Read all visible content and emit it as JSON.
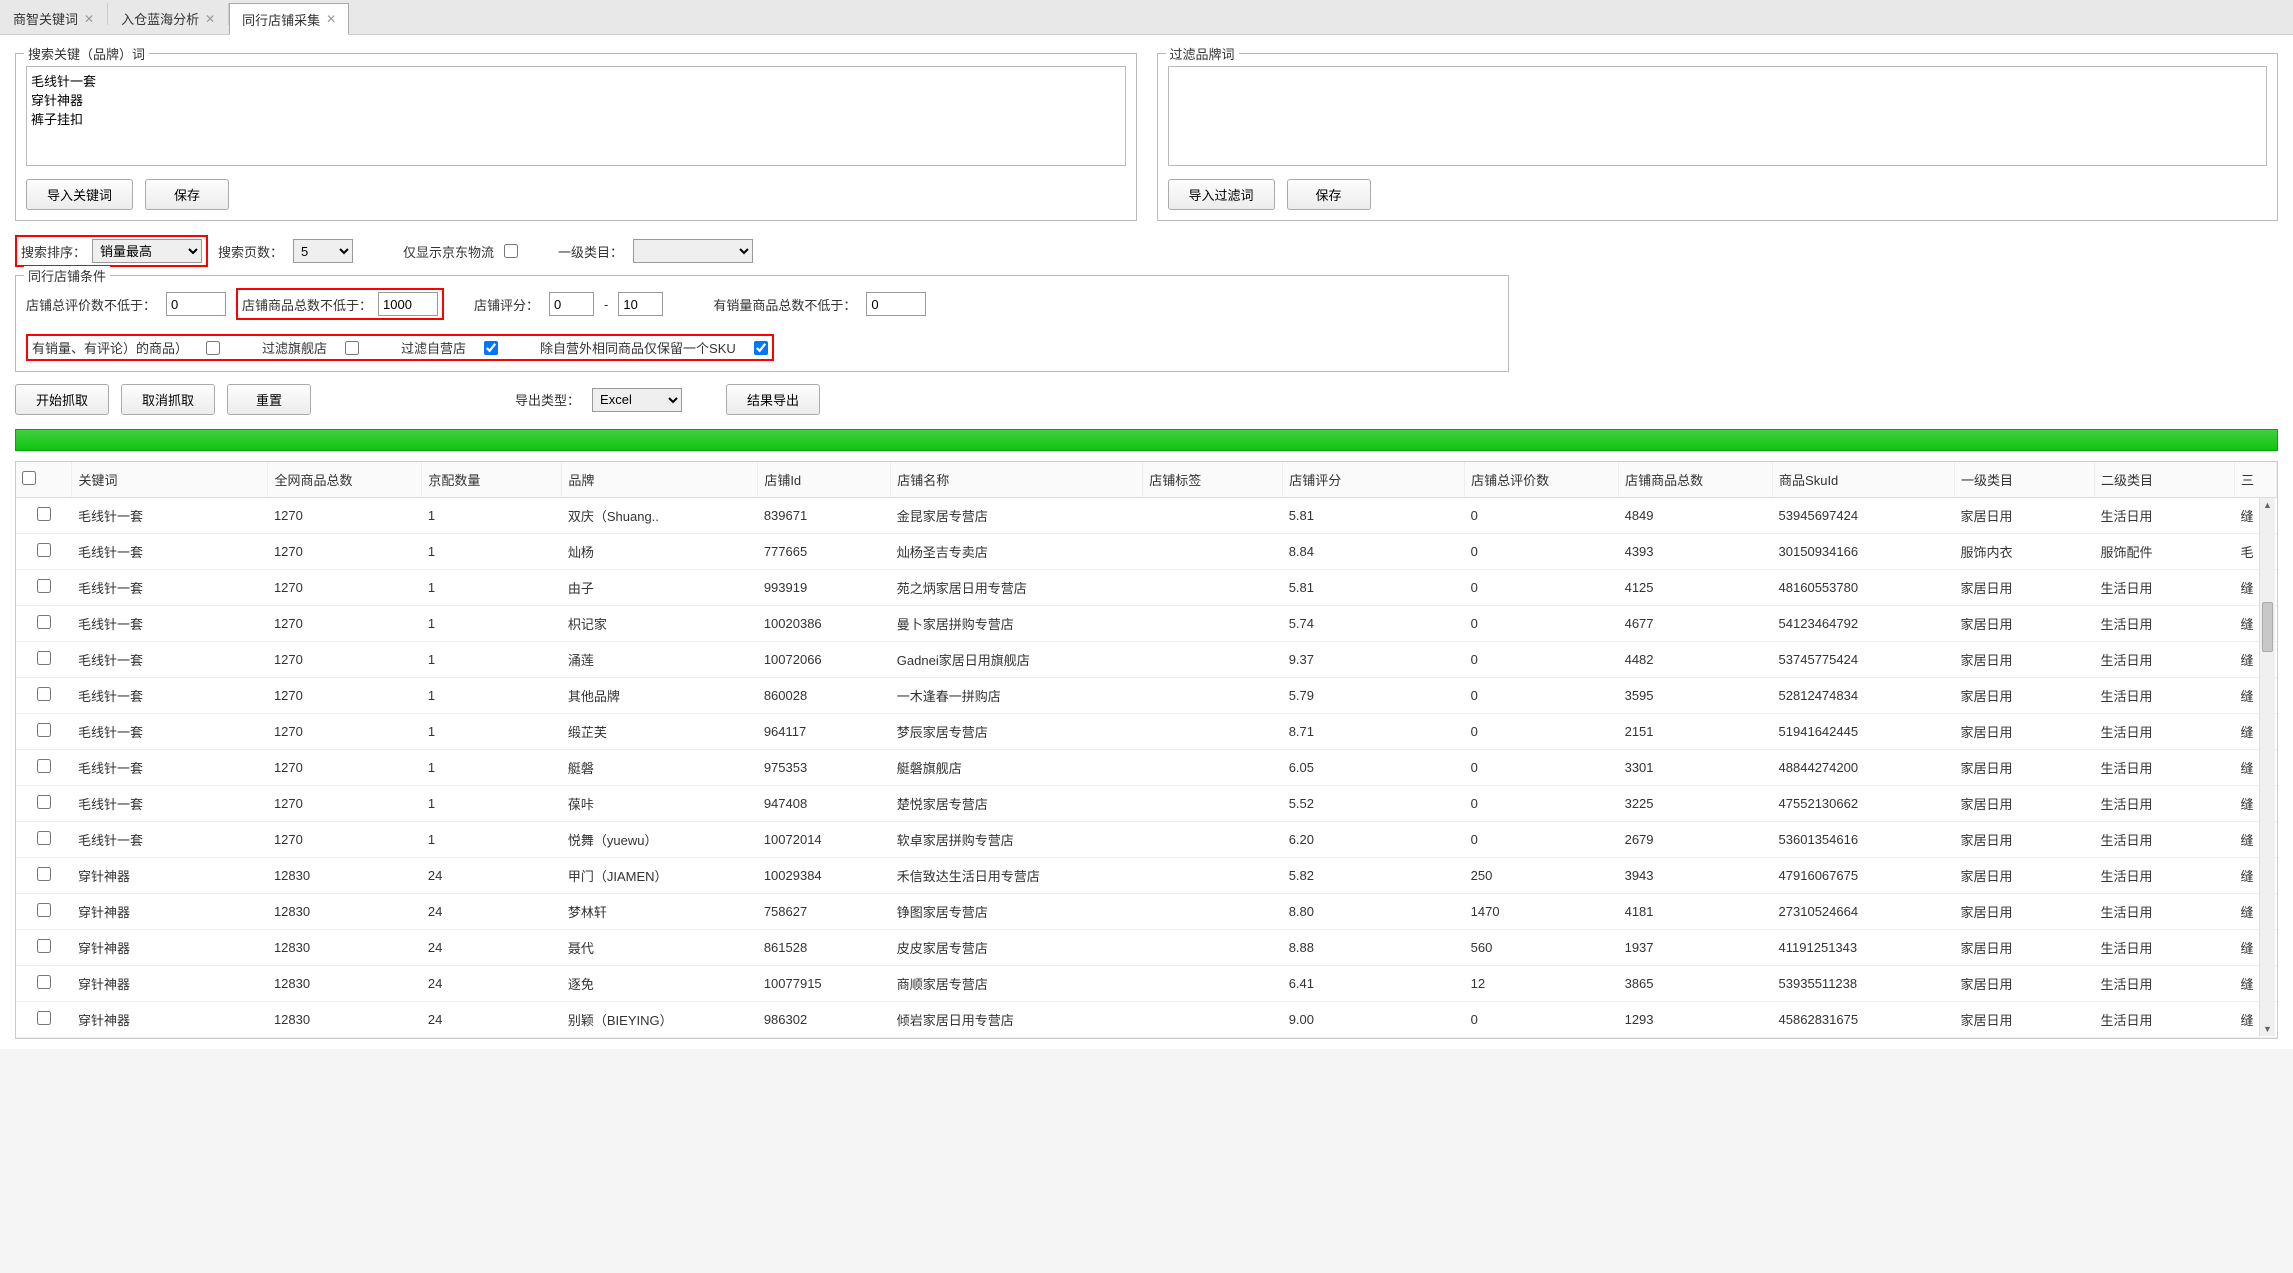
{
  "tabs": [
    {
      "label": "商智关键词",
      "active": false
    },
    {
      "label": "入仓蓝海分析",
      "active": false
    },
    {
      "label": "同行店铺采集",
      "active": true
    }
  ],
  "searchKw": {
    "legend": "搜索关键（品牌）词",
    "value": "毛线针一套\n穿针神器\n裤子挂扣",
    "btn_import": "导入关键词",
    "btn_save": "保存"
  },
  "filterBrand": {
    "legend": "过滤品牌词",
    "value": "",
    "btn_import": "导入过滤词",
    "btn_save": "保存"
  },
  "sortRow": {
    "label_sort": "搜索排序：",
    "sort_value": "销量最高",
    "label_pages": "搜索页数：",
    "pages_value": "5",
    "label_jd": "仅显示京东物流",
    "label_cat1": "一级类目："
  },
  "peerCond": {
    "legend": "同行店铺条件",
    "label_totalReview": "店铺总评价数不低于：",
    "totalReview_value": "0",
    "label_totalGoods": "店铺商品总数不低于：",
    "totalGoods_value": "1000",
    "label_shopScore": "店铺评分：",
    "score_from": "0",
    "score_to": "10",
    "label_hasSaleGoods": "有销量商品总数不低于：",
    "hasSaleGoods_value": "0",
    "label_hasSaleReview": "有销量、有评论）的商品）",
    "label_filterFlagship": "过滤旗舰店",
    "label_filterSelf": "过滤自营店",
    "label_dedupSku": "除自营外相同商品仅保留一个SKU"
  },
  "actions": {
    "btn_start": "开始抓取",
    "btn_cancel": "取消抓取",
    "btn_reset": "重置",
    "label_exportType": "导出类型：",
    "exportType_value": "Excel",
    "btn_export": "结果导出"
  },
  "grid": {
    "headers": [
      "关键词",
      "全网商品总数",
      "京配数量",
      "品牌",
      "店铺Id",
      "店铺名称",
      "店铺标签",
      "店铺评分",
      "店铺总评价数",
      "店铺商品总数",
      "商品SkuId",
      "一级类目",
      "二级类目",
      "三"
    ],
    "rows": [
      [
        "毛线针一套",
        "1270",
        "1",
        "双庆（Shuang..",
        "839671",
        "金昆家居专营店",
        "",
        "5.81",
        "0",
        "4849",
        "53945697424",
        "家居日用",
        "生活日用",
        "缝"
      ],
      [
        "毛线针一套",
        "1270",
        "1",
        "灿杨",
        "777665",
        "灿杨圣吉专卖店",
        "",
        "8.84",
        "0",
        "4393",
        "30150934166",
        "服饰内衣",
        "服饰配件",
        "毛"
      ],
      [
        "毛线针一套",
        "1270",
        "1",
        "由子",
        "993919",
        "苑之炳家居日用专营店",
        "",
        "5.81",
        "0",
        "4125",
        "48160553780",
        "家居日用",
        "生活日用",
        "缝"
      ],
      [
        "毛线针一套",
        "1270",
        "1",
        "枳记家",
        "10020386",
        "曼卜家居拼购专营店",
        "",
        "5.74",
        "0",
        "4677",
        "54123464792",
        "家居日用",
        "生活日用",
        "缝"
      ],
      [
        "毛线针一套",
        "1270",
        "1",
        "涌莲",
        "10072066",
        "Gadnei家居日用旗舰店",
        "",
        "9.37",
        "0",
        "4482",
        "53745775424",
        "家居日用",
        "生活日用",
        "缝"
      ],
      [
        "毛线针一套",
        "1270",
        "1",
        "其他品牌",
        "860028",
        "一木逢春一拼购店",
        "",
        "5.79",
        "0",
        "3595",
        "52812474834",
        "家居日用",
        "生活日用",
        "缝"
      ],
      [
        "毛线针一套",
        "1270",
        "1",
        "缎芷芙",
        "964117",
        "梦辰家居专营店",
        "",
        "8.71",
        "0",
        "2151",
        "51941642445",
        "家居日用",
        "生活日用",
        "缝"
      ],
      [
        "毛线针一套",
        "1270",
        "1",
        "艇磐",
        "975353",
        "艇磐旗舰店",
        "",
        "6.05",
        "0",
        "3301",
        "48844274200",
        "家居日用",
        "生活日用",
        "缝"
      ],
      [
        "毛线针一套",
        "1270",
        "1",
        "葆咔",
        "947408",
        "楚悦家居专营店",
        "",
        "5.52",
        "0",
        "3225",
        "47552130662",
        "家居日用",
        "生活日用",
        "缝"
      ],
      [
        "毛线针一套",
        "1270",
        "1",
        "悦舞（yuewu）",
        "10072014",
        "软卓家居拼购专营店",
        "",
        "6.20",
        "0",
        "2679",
        "53601354616",
        "家居日用",
        "生活日用",
        "缝"
      ],
      [
        "穿针神器",
        "12830",
        "24",
        "甲门（JIAMEN）",
        "10029384",
        "禾信致达生活日用专营店",
        "",
        "5.82",
        "250",
        "3943",
        "47916067675",
        "家居日用",
        "生活日用",
        "缝"
      ],
      [
        "穿针神器",
        "12830",
        "24",
        "梦林轩",
        "758627",
        "铮图家居专营店",
        "",
        "8.80",
        "1470",
        "4181",
        "27310524664",
        "家居日用",
        "生活日用",
        "缝"
      ],
      [
        "穿针神器",
        "12830",
        "24",
        "聂代",
        "861528",
        "皮皮家居专营店",
        "",
        "8.88",
        "560",
        "1937",
        "41191251343",
        "家居日用",
        "生活日用",
        "缝"
      ],
      [
        "穿针神器",
        "12830",
        "24",
        "逐免",
        "10077915",
        "商顺家居专营店",
        "",
        "6.41",
        "12",
        "3865",
        "53935511238",
        "家居日用",
        "生活日用",
        "缝"
      ],
      [
        "穿针神器",
        "12830",
        "24",
        "别颖（BIEYING）",
        "986302",
        "倾岩家居日用专营店",
        "",
        "9.00",
        "0",
        "1293",
        "45862831675",
        "家居日用",
        "生活日用",
        "缝"
      ]
    ]
  }
}
